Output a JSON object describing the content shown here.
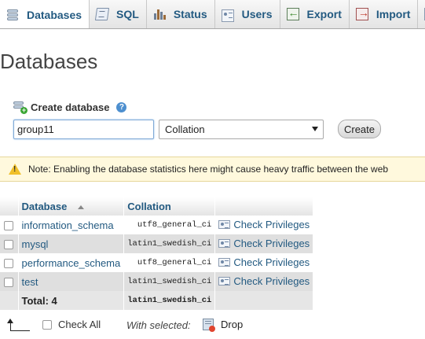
{
  "tabs": [
    {
      "label": "Databases",
      "icon": "database-icon",
      "active": true
    },
    {
      "label": "SQL",
      "icon": "sql-icon",
      "active": false
    },
    {
      "label": "Status",
      "icon": "status-icon",
      "active": false
    },
    {
      "label": "Users",
      "icon": "users-icon",
      "active": false
    },
    {
      "label": "Export",
      "icon": "export-icon",
      "active": false
    },
    {
      "label": "Import",
      "icon": "import-icon",
      "active": false
    }
  ],
  "page": {
    "title": "Databases"
  },
  "create": {
    "label": "Create database",
    "help_icon": "help-icon",
    "name_value": "group11",
    "collation_value": "Collation",
    "button_label": "Create"
  },
  "notice": {
    "icon": "warning-icon",
    "text": "Note: Enabling the database statistics here might cause heavy traffic between the web"
  },
  "table": {
    "headers": {
      "database": "Database",
      "collation": "Collation"
    },
    "rows": [
      {
        "name": "information_schema",
        "collation": "utf8_general_ci",
        "action": "Check Privileges"
      },
      {
        "name": "mysql",
        "collation": "latin1_swedish_ci",
        "action": "Check Privileges"
      },
      {
        "name": "performance_schema",
        "collation": "utf8_general_ci",
        "action": "Check Privileges"
      },
      {
        "name": "test",
        "collation": "latin1_swedish_ci",
        "action": "Check Privileges"
      }
    ],
    "total_label": "Total: 4",
    "total_collation": "latin1_swedish_ci"
  },
  "footer": {
    "check_all_label": "Check All",
    "with_selected_label": "With selected:",
    "drop_label": "Drop"
  },
  "colors": {
    "link": "#235a81",
    "notice_bg": "#fff9dd",
    "row_alt": "#dfdfdf"
  }
}
